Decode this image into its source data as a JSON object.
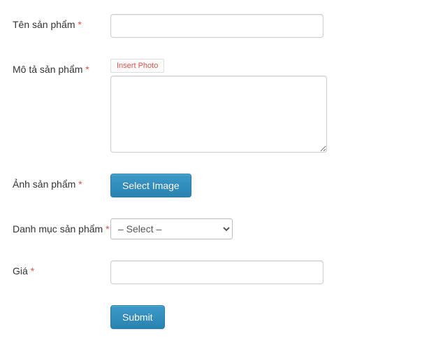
{
  "fields": {
    "product_name": {
      "label": "Tên sản phẩm",
      "required": true,
      "value": ""
    },
    "description": {
      "label": "Mô tả sản phẩm",
      "required": true,
      "insert_photo_label": "Insert Photo",
      "value": ""
    },
    "image": {
      "label": "Ảnh sản phẩm",
      "required": true,
      "button_label": "Select Image"
    },
    "category": {
      "label": "Danh mục sản phẩm",
      "required": true,
      "selected": "– Select –",
      "options": [
        "– Select –"
      ]
    },
    "price": {
      "label": "Giá",
      "required": true,
      "value": ""
    }
  },
  "submit_label": "Submit",
  "required_marker": "*"
}
